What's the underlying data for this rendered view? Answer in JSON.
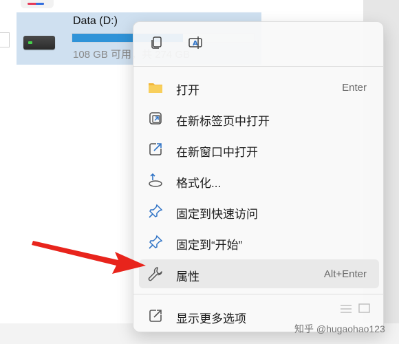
{
  "drive": {
    "name": "Data (D:)",
    "space_text": "108 GB 可用，共 274 GB",
    "used_fraction": 0.61
  },
  "quick_actions": [
    {
      "name": "copy",
      "icon": "copy-icon"
    },
    {
      "name": "rename",
      "icon": "rename-icon"
    }
  ],
  "menu_items": [
    {
      "label": "打开",
      "accel": "Enter",
      "icon": "folder-icon"
    },
    {
      "label": "在新标签页中打开",
      "accel": "",
      "icon": "open-new-tab-icon"
    },
    {
      "label": "在新窗口中打开",
      "accel": "",
      "icon": "open-new-window-icon"
    },
    {
      "label": "格式化...",
      "accel": "",
      "icon": "format-icon"
    },
    {
      "label": "固定到快速访问",
      "accel": "",
      "icon": "pin-icon"
    },
    {
      "label": "固定到“开始”",
      "accel": "",
      "icon": "pin-icon"
    },
    {
      "label": "属性",
      "accel": "Alt+Enter",
      "icon": "wrench-icon"
    },
    {
      "label": "显示更多选项",
      "accel": "",
      "icon": "share-icon"
    }
  ],
  "watermark": "知乎 @hugaohao123",
  "colors": {
    "accent": "#2f93d8",
    "pin": "#2f73c6",
    "arrow": "#e8241c"
  }
}
